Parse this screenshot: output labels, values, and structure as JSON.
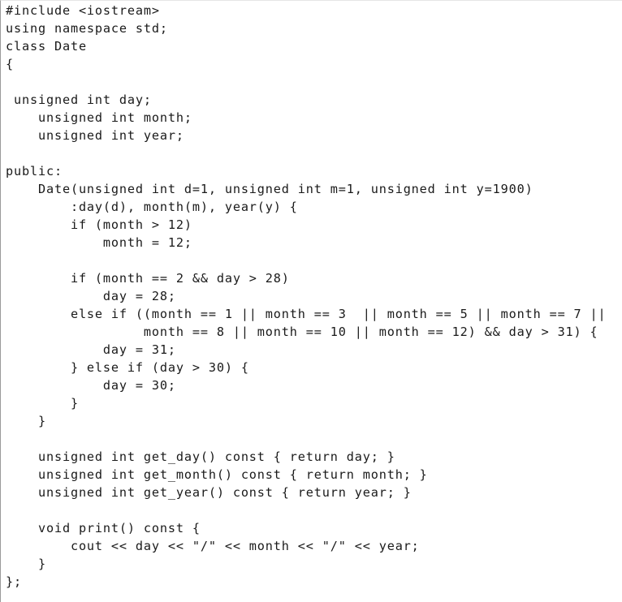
{
  "code": {
    "language": "cpp",
    "lines": [
      "#include <iostream>",
      "using namespace std;",
      "class Date",
      "{",
      "",
      " unsigned int day;",
      "    unsigned int month;",
      "    unsigned int year;",
      "",
      "public:",
      "    Date(unsigned int d=1, unsigned int m=1, unsigned int y=1900)",
      "        :day(d), month(m), year(y) {",
      "        if (month > 12)",
      "            month = 12;",
      "",
      "        if (month == 2 && day > 28)",
      "            day = 28;",
      "        else if ((month == 1 || month == 3  || month == 5 || month == 7 ||",
      "                 month == 8 || month == 10 || month == 12) && day > 31) {",
      "            day = 31;",
      "        } else if (day > 30) {",
      "            day = 30;",
      "        }",
      "    }",
      "",
      "    unsigned int get_day() const { return day; }",
      "    unsigned int get_month() const { return month; }",
      "    unsigned int get_year() const { return year; }",
      "",
      "    void print() const {",
      "        cout << day << \"/\" << month << \"/\" << year;",
      "    }",
      "};"
    ]
  }
}
